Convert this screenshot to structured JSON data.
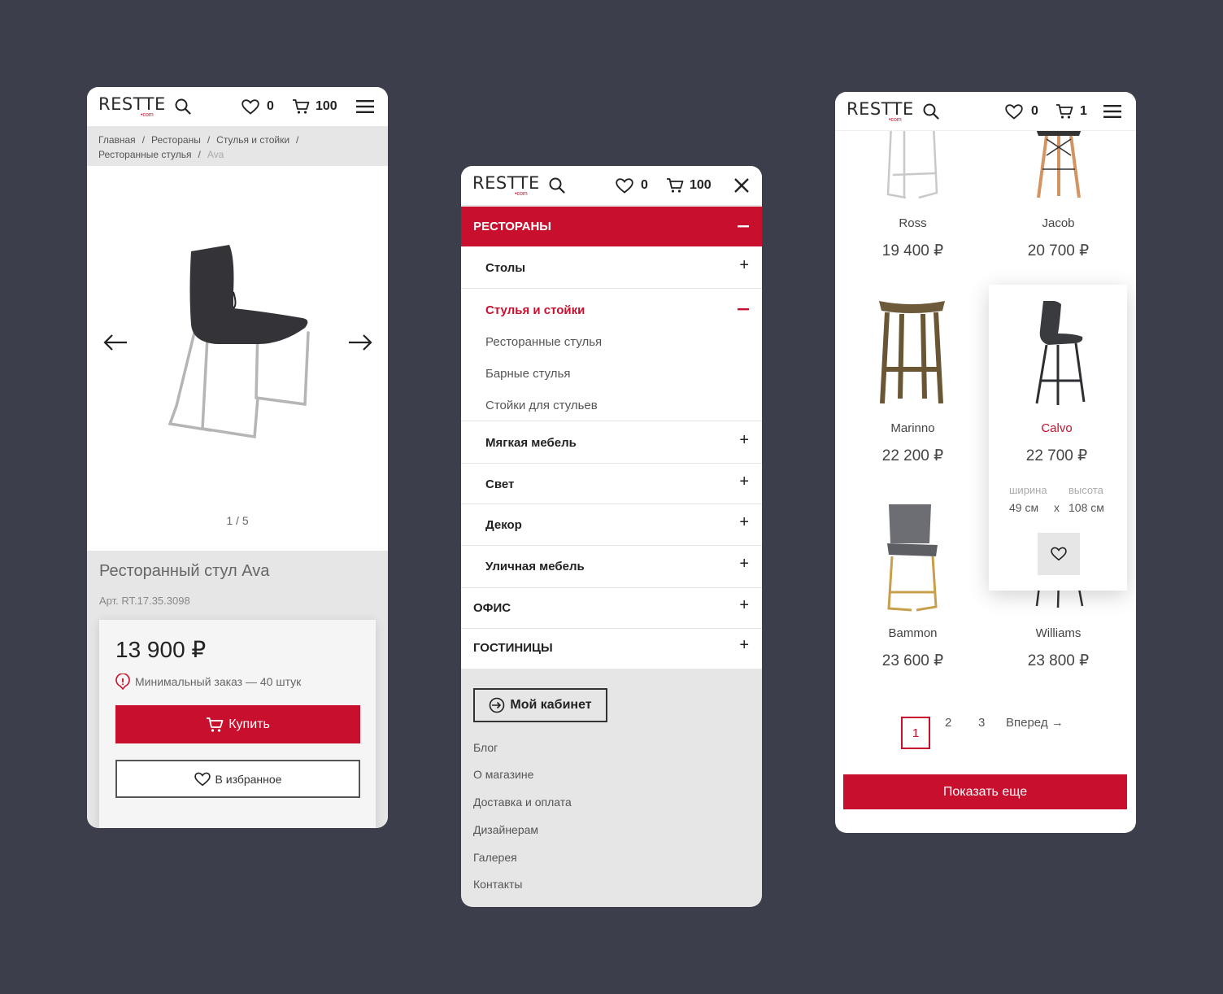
{
  "brand": {
    "logo": "RESTTE",
    "logo_suffix": "•com",
    "accent": "#c8102e",
    "background": "#3c3f4b"
  },
  "screen_product": {
    "header": {
      "favorites_count": "0",
      "cart_count": "100"
    },
    "breadcrumbs": [
      "Главная",
      "Рестораны",
      "Стулья и стойки",
      "Ресторанные стулья",
      "Ava"
    ],
    "gallery": {
      "counter": "1 / 5"
    },
    "product": {
      "title": "Ресторанный стул Ava",
      "article": "Арт. RT.17.35.3098",
      "price": "13 900 ₽",
      "min_order": "Минимальный заказ — 40 штук",
      "buy_label": "Купить",
      "favorite_label": "В избранное"
    }
  },
  "screen_menu": {
    "header": {
      "favorites_count": "0",
      "cart_count": "100"
    },
    "sections": {
      "restaurants": "РЕСТОРАНЫ",
      "office": "ОФИС",
      "hotels": "ГОСТИНИЦЫ"
    },
    "categories": {
      "tables": "Столы",
      "chairs": "Стулья и стойки",
      "soft": "Мягкая мебель",
      "light": "Свет",
      "decor": "Декор",
      "outdoor": "Уличная мебель"
    },
    "chairs_sub": [
      "Ресторанные стулья",
      "Барные стулья",
      "Стойки для стульев"
    ],
    "cabinet_label": "Мой кабинет",
    "footer_links": [
      "Блог",
      "О магазине",
      "Доставка и оплата",
      "Дизайнерам",
      "Галерея",
      "Контакты"
    ]
  },
  "screen_catalog": {
    "header": {
      "favorites_count": "0",
      "cart_count": "1"
    },
    "products": [
      {
        "name": "Ross",
        "price": "19 400 ₽"
      },
      {
        "name": "Jacob",
        "price": "20 700 ₽"
      },
      {
        "name": "Marinno",
        "price": "22 200 ₽"
      },
      {
        "name": "Calvo",
        "price": "22 700 ₽"
      },
      {
        "name": "Bammon",
        "price": "23 600 ₽"
      },
      {
        "name": "Williams",
        "price": "23 800 ₽"
      }
    ],
    "hover_card": {
      "width_label": "ширина",
      "height_label": "высота",
      "width_value": "49 см",
      "times": "x",
      "height_value": "108 см"
    },
    "pagination": {
      "current": "1",
      "pages": [
        "2",
        "3"
      ],
      "next": "Вперед →"
    },
    "show_more_label": "Показать еще"
  }
}
